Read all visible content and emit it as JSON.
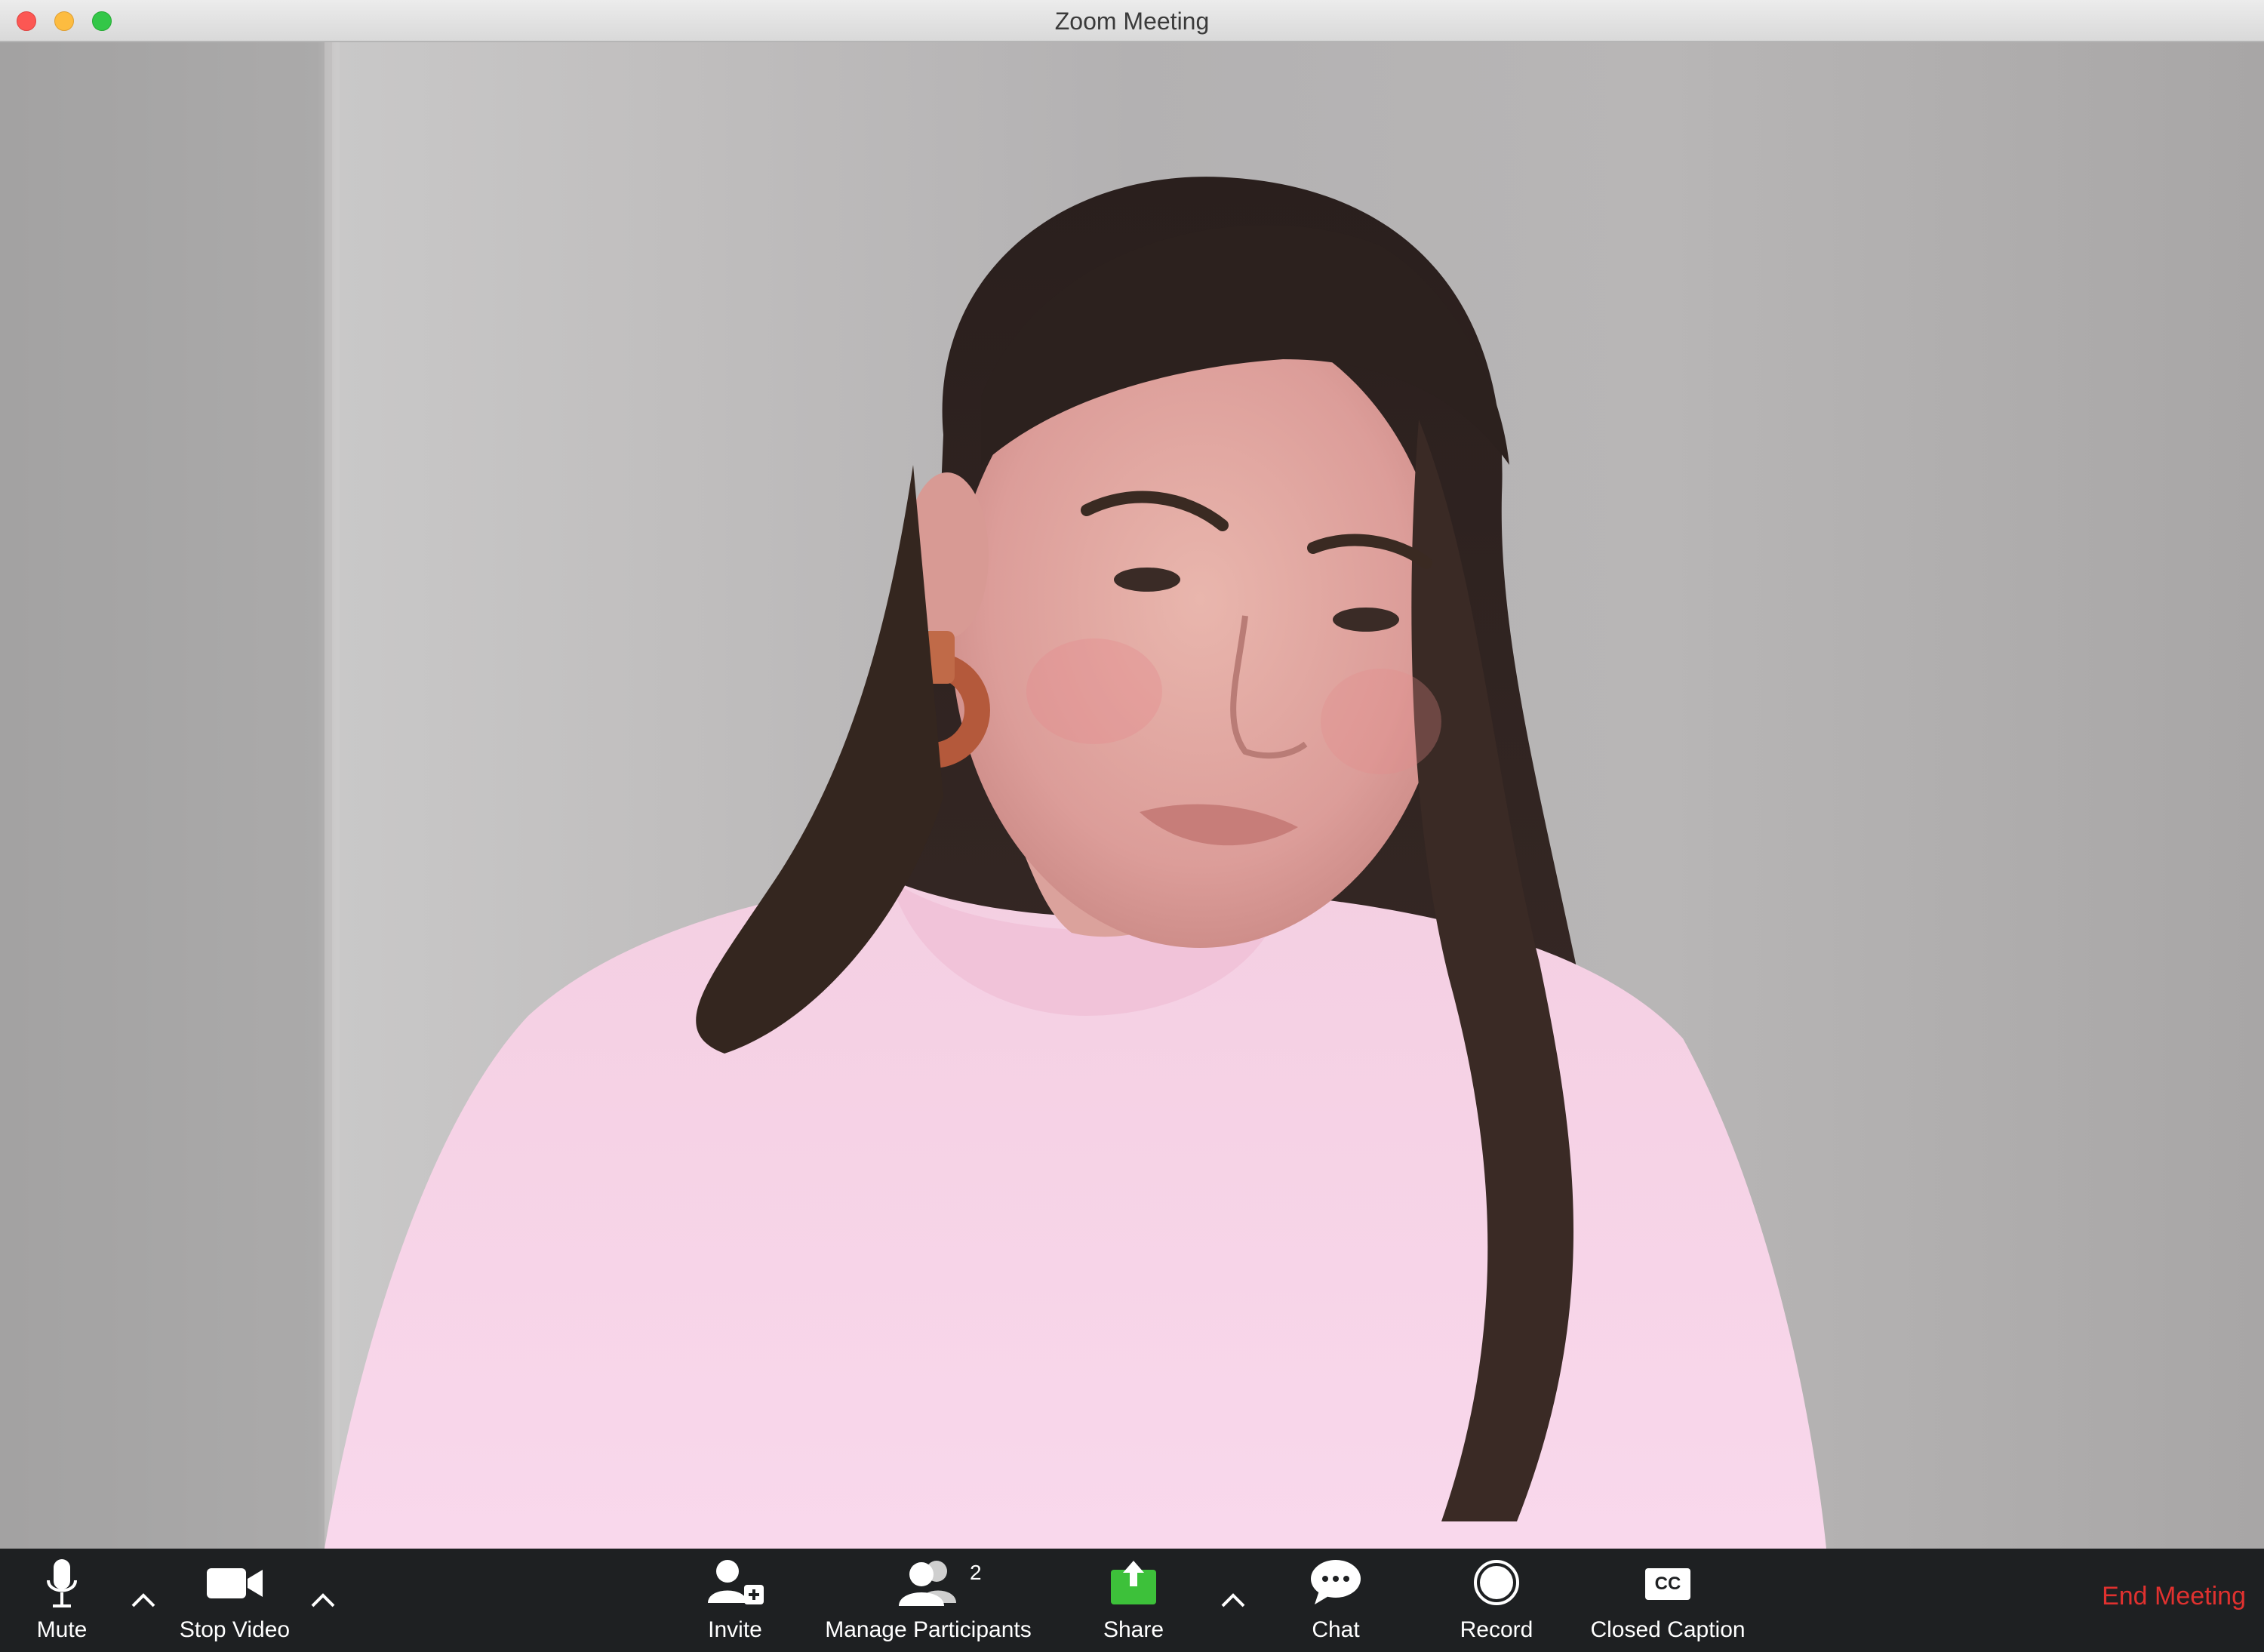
{
  "window": {
    "title": "Zoom Meeting"
  },
  "video": {
    "description_icon": "participant-video-feed"
  },
  "toolbar": {
    "mute_label": "Mute",
    "stop_video_label": "Stop Video",
    "invite_label": "Invite",
    "manage_participants_label": "Manage Participants",
    "participant_count": "2",
    "share_label": "Share",
    "chat_label": "Chat",
    "record_label": "Record",
    "closed_caption_label": "Closed Caption",
    "cc_badge": "CC",
    "end_meeting_label": "End Meeting"
  },
  "colors": {
    "toolbar_bg": "#1e2022",
    "share_green": "#3dc13a",
    "end_meeting_red": "#e0312f",
    "close_red": "#fc5753",
    "minimize_yellow": "#fdbc40",
    "maximize_green": "#33c748"
  }
}
